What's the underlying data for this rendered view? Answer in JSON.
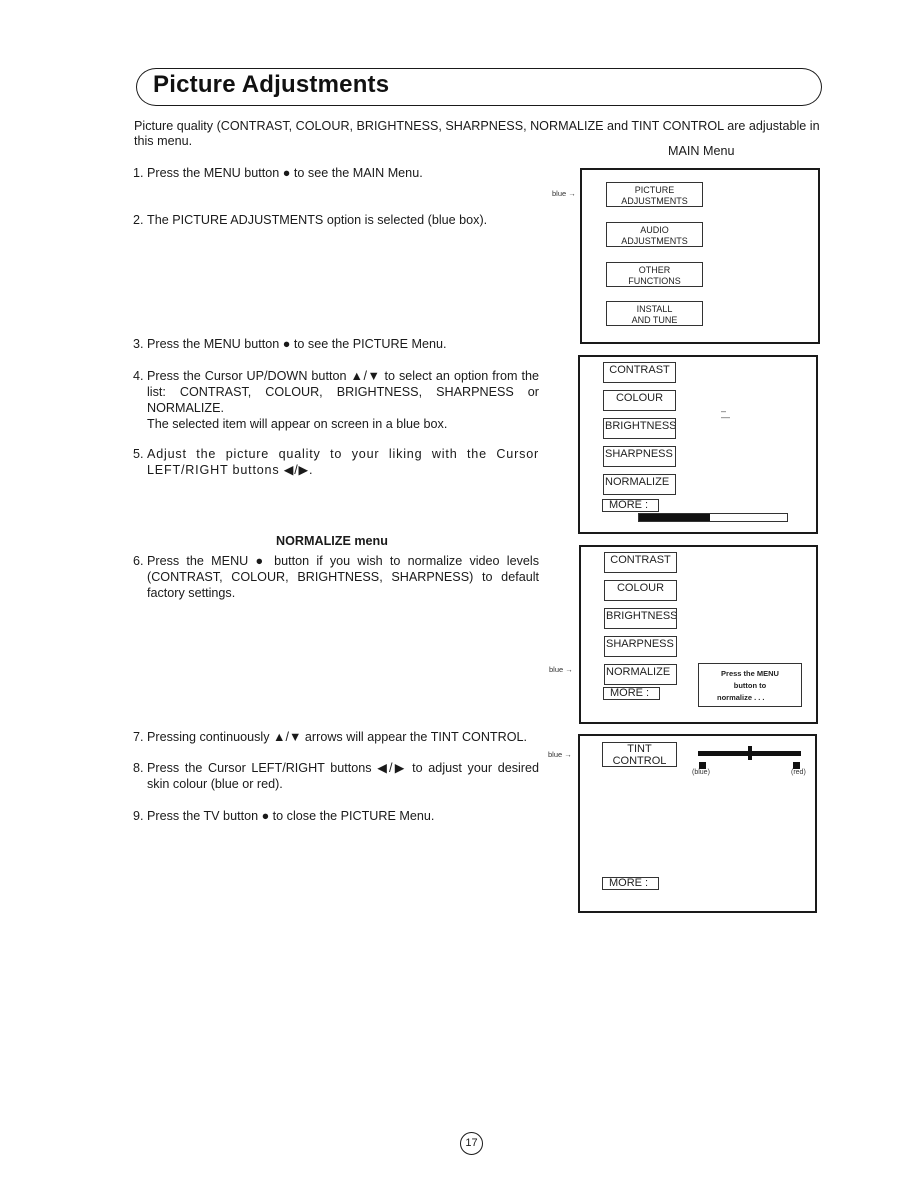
{
  "title": "Picture Adjustments",
  "intro": "Picture quality (CONTRAST, COLOUR, BRIGHTNESS, SHARPNESS, NORMALIZE and TINT CONTROL are adjustable in this menu.",
  "steps": [
    {
      "num": "1.",
      "text": "Press the MENU button ● to see the MAIN Menu."
    },
    {
      "num": "2.",
      "text": "The PICTURE ADJUSTMENTS option is selected (blue box)."
    },
    {
      "num": "3.",
      "text": "Press the MENU button ● to see the PICTURE Menu."
    },
    {
      "num": "4.",
      "text": "Press the Cursor UP/DOWN button ▲/▼ to select an option from the list: CONTRAST, COLOUR, BRIGHTNESS, SHARPNESS or NORMALIZE.",
      "note": "The selected item will appear on screen in a blue box."
    },
    {
      "num": "5.",
      "text": "Adjust the picture quality to your liking with the Cursor LEFT/RIGHT buttons ◀/▶."
    },
    {
      "num": "6.",
      "text": "Press the MENU ● button if you wish to normalize video levels (CONTRAST, COLOUR, BRIGHTNESS, SHARPNESS) to default factory settings."
    },
    {
      "num": "7.",
      "text": "Pressing continuously ▲/▼ arrows will appear the TINT CONTROL."
    },
    {
      "num": "8.",
      "text": "Press the Cursor LEFT/RIGHT buttons ◀/▶ to adjust your desired skin colour (blue or red)."
    },
    {
      "num": "9.",
      "text": "Press the TV button ● to close the PICTURE Menu."
    }
  ],
  "normalize_heading": "NORMALIZE menu",
  "blue_marker": "blue →",
  "main_menu": {
    "caption": "MAIN Menu",
    "options": [
      {
        "line1": "PICTURE",
        "line2": "ADJUSTMENTS"
      },
      {
        "line1": "AUDIO",
        "line2": "ADJUSTMENTS"
      },
      {
        "line1": "OTHER",
        "line2": "FUNCTIONS"
      },
      {
        "line1": "INSTALL",
        "line2": "AND TUNE"
      }
    ]
  },
  "picture_menu": {
    "items": [
      "CONTRAST",
      "COLOUR",
      "BRIGHTNESS",
      "SHARPNESS",
      "NORMALIZE"
    ],
    "more": "MORE :",
    "level_percent": 48
  },
  "normalize_menu": {
    "items": [
      "CONTRAST",
      "COLOUR",
      "BRIGHTNESS",
      "SHARPNESS",
      "NORMALIZE"
    ],
    "more": "MORE :",
    "hint": [
      "Press the MENU",
      "button to",
      "normalize . . ."
    ]
  },
  "tint_menu": {
    "label_line1": "TINT",
    "label_line2": "CONTROL",
    "left_caption": "(blue)",
    "right_caption": "(red)",
    "tint_percent": 50,
    "more": "MORE :"
  },
  "page_number": "17"
}
